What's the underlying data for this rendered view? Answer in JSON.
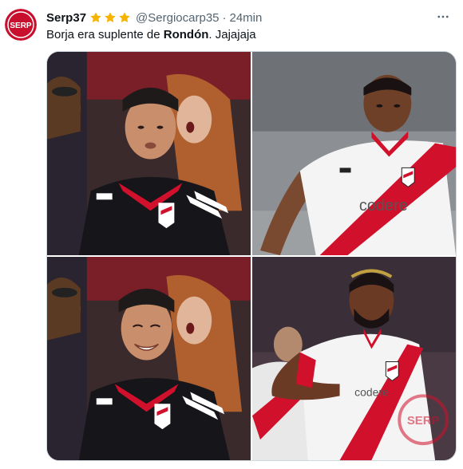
{
  "tweet": {
    "author": {
      "display_name": "Serp37",
      "handle": "@Sergiocarp35",
      "avatar_text": "SERP",
      "badge_icons": [
        "star-icon",
        "star-icon",
        "star-icon"
      ]
    },
    "separator": "·",
    "timestamp": "24min",
    "more_icon": "more-horizontal-icon",
    "text_part1": "Borja era suplente de ",
    "text_bold": "Rondón",
    "text_part2": ". Jajajaja",
    "media": {
      "panels": [
        {
          "name": "fan-serious-photo",
          "shirt_brand": "adidas"
        },
        {
          "name": "player-rondon-photo",
          "shirt_sponsor": "codere"
        },
        {
          "name": "fan-smiling-photo",
          "shirt_brand": "adidas"
        },
        {
          "name": "player-borja-photo",
          "shirt_sponsor": "codere",
          "watermark": "SERP"
        }
      ]
    }
  },
  "colors": {
    "star": "#f4b400",
    "avatar_red": "#c8102e",
    "handle_gray": "#536471",
    "river_red": "#d1102c",
    "jersey_white": "#f4f4f4"
  }
}
